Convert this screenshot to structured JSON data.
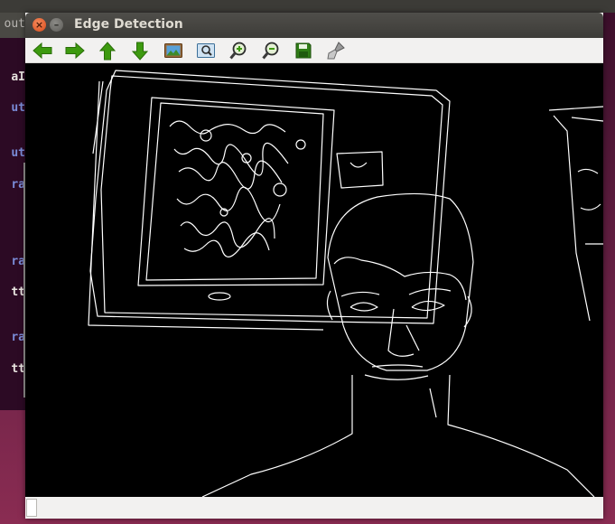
{
  "window": {
    "title": "Edge Detection"
  },
  "background_window": {
    "partial_title": "out",
    "terminal_fragments": [
      "aI",
      "ut",
      "ut",
      "ra",
      "ra",
      "tt",
      "ra",
      "tt"
    ]
  },
  "toolbar": {
    "tools": [
      {
        "icon": "arrow-left-icon"
      },
      {
        "icon": "arrow-right-icon"
      },
      {
        "icon": "arrow-up-icon"
      },
      {
        "icon": "arrow-down-icon"
      },
      {
        "icon": "image-icon"
      },
      {
        "icon": "zoom-fit-icon"
      },
      {
        "icon": "zoom-in-icon"
      },
      {
        "icon": "zoom-out-icon"
      },
      {
        "icon": "save-icon"
      },
      {
        "icon": "properties-brush-icon"
      }
    ]
  },
  "status": {
    "text": ""
  },
  "colors": {
    "titlebar": "#3d3c38",
    "toolbar": "#f2f1f0",
    "canvas": "#000000",
    "edge": "#ffffff",
    "arrow": "#3d9a0f"
  }
}
